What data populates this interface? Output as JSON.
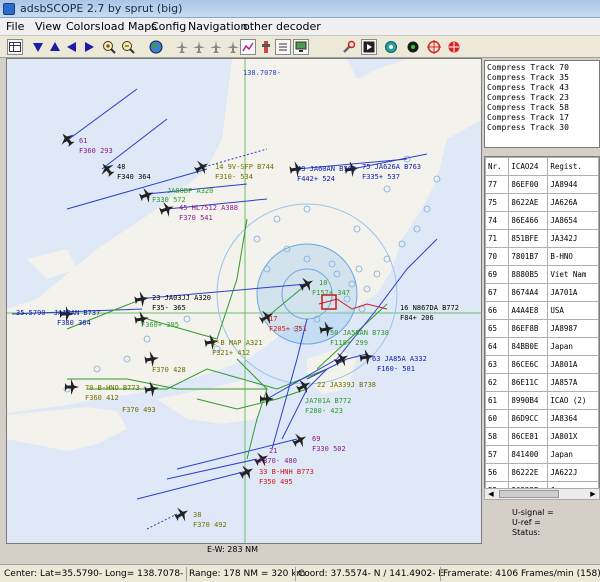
{
  "window": {
    "title": "adsbSCOPE 2.7 by sprut  (big)"
  },
  "menu": [
    "File",
    "View",
    "Colors",
    "load Maps",
    "Config",
    "Navigation",
    "other",
    "decoder"
  ],
  "toolbar_icons": [
    "table-icon",
    "arrow-down-icon",
    "arrow-up-icon",
    "arrow-left-icon",
    "arrow-right-icon",
    "zoom-in-icon",
    "zoom-out-icon",
    "globe-icon",
    "aircraft-small-icon",
    "aircraft-medium-icon",
    "aircraft-large-icon",
    "aircraft-xl-icon",
    "chart-icon",
    "airport-icon",
    "list-icon",
    "monitor-icon",
    "tools-icon",
    "play-icon",
    "target-icon",
    "circle-icon",
    "crosshair-icon",
    "crosshair-red-icon"
  ],
  "colors": {
    "map_bg": "#dfe8f6",
    "track_blue": "#2a40c8",
    "track_green": "#2f9a2f",
    "label_blue": "#1020b0",
    "label_purple": "#8a1a8a",
    "label_red": "#d01818",
    "label_olive": "#707000"
  },
  "log_lines": [
    "Compress Track 70",
    "Compress Track 35",
    "Compress Track 43",
    "Compress Track 23",
    "Compress Track 58",
    "Compress Track 17",
    "Compress Track 30"
  ],
  "table": {
    "headers": [
      "Nr.",
      "ICAO24",
      "Regist."
    ],
    "rows": [
      [
        "77",
        "86EF00",
        "JA8944"
      ],
      [
        "75",
        "8622AE",
        "JA626A"
      ],
      [
        "74",
        "86E466",
        "JA8654"
      ],
      [
        "71",
        "851BFE",
        "JA342J"
      ],
      [
        "70",
        "7801B7",
        "B-HNO"
      ],
      [
        "69",
        "8880B5",
        "Viet Nam"
      ],
      [
        "67",
        "8674A4",
        "JA701A"
      ],
      [
        "66",
        "A4A4E8",
        "USA"
      ],
      [
        "65",
        "86EF8B",
        "JA8987"
      ],
      [
        "64",
        "84BB0E",
        "Japan"
      ],
      [
        "63",
        "86CE6C",
        "JA801A"
      ],
      [
        "62",
        "86E11C",
        "JA857A"
      ],
      [
        "61",
        "8990B4",
        "ICAO (2)"
      ],
      [
        "60",
        "86D9CC",
        "JA8364"
      ],
      [
        "58",
        "86CE81",
        "JA801X"
      ],
      [
        "57",
        "841400",
        "Japan"
      ],
      [
        "56",
        "86222E",
        "JA622J"
      ],
      [
        "55",
        "86222E",
        "Japan"
      ]
    ]
  },
  "signal": {
    "u_signal": "U-signal =",
    "u_ref": "U-ref =",
    "status": "Status:"
  },
  "map": {
    "ew_label": "E-W: 283 NM",
    "top_label": "138.7078-",
    "aircraft_labels": [
      {
        "t": "61",
        "c": "purple"
      },
      {
        "t": "F360  293",
        "c": "purple"
      },
      {
        "t": "48",
        "c": "black"
      },
      {
        "t": "F340  364",
        "c": "black"
      },
      {
        "t": "14  9V-SFP  B744",
        "c": "olive"
      },
      {
        "t": "F310- 534",
        "c": "olive"
      },
      {
        "t": "43  JA60AN  B763",
        "c": "blue"
      },
      {
        "t": "F442+ 524",
        "c": "blue"
      },
      {
        "t": "75  JA626A  B763",
        "c": "blue"
      },
      {
        "t": "F335+ 537",
        "c": "blue"
      },
      {
        "t": "JA80DP  A320",
        "c": "green"
      },
      {
        "t": "F330  572",
        "c": "green"
      },
      {
        "t": "45  HL7512  A388",
        "c": "purple"
      },
      {
        "t": "F370  541",
        "c": "purple"
      },
      {
        "t": "23  JA03JJ  A320",
        "c": "black"
      },
      {
        "t": "F35- 365",
        "c": "black"
      },
      {
        "t": "35.5790-  JA18AN  B737",
        "c": "blue"
      },
      {
        "t": "F380  384",
        "c": "blue"
      },
      {
        "t": "F360+ 395",
        "c": "green"
      },
      {
        "t": "17",
        "c": "red"
      },
      {
        "t": "F205+ 351",
        "c": "red"
      },
      {
        "t": "10",
        "c": "green"
      },
      {
        "t": "F157+ 347",
        "c": "green"
      },
      {
        "t": "16  N867DA  B772",
        "c": "black"
      },
      {
        "t": "F84+ 206",
        "c": "black"
      },
      {
        "t": "50  JA58AN  B738",
        "c": "green"
      },
      {
        "t": "F118+ 299",
        "c": "green"
      },
      {
        "t": "2-B  MAP  A321",
        "c": "olive"
      },
      {
        "t": "F321+ 412",
        "c": "olive"
      },
      {
        "t": "63  JA85A  A332",
        "c": "blue"
      },
      {
        "t": "F160- 501",
        "c": "blue"
      },
      {
        "t": "F370  428",
        "c": "olive"
      },
      {
        "t": "70  B-HNO  B773",
        "c": "olive"
      },
      {
        "t": "F360  412",
        "c": "olive"
      },
      {
        "t": "F370  493",
        "c": "olive"
      },
      {
        "t": "22  JA339J  B738",
        "c": "olive"
      },
      {
        "t": "JA701A  B772",
        "c": "green"
      },
      {
        "t": "F280- 423",
        "c": "green"
      },
      {
        "t": "69",
        "c": "purple"
      },
      {
        "t": "F330  502",
        "c": "purple"
      },
      {
        "t": "21",
        "c": "purple"
      },
      {
        "t": "F370- 480",
        "c": "purple"
      },
      {
        "t": "33  B-HNH  B773",
        "c": "red"
      },
      {
        "t": "F350  495",
        "c": "red"
      },
      {
        "t": "38",
        "c": "olive"
      },
      {
        "t": "F370  492",
        "c": "olive"
      }
    ]
  },
  "statusbar": {
    "center": "Center: Lat=35.5790- Long= 138.7078-",
    "range": "Range: 178 NM = 320 km",
    "coord": "Coord: 37.5574- N / 141.4902- E",
    "framerate": "Framerate:  4106 Frames/min (158)"
  }
}
